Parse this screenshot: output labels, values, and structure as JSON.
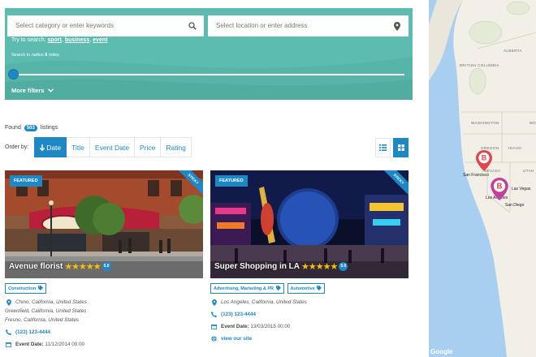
{
  "search": {
    "keyword_placeholder": "Select category or enter keywords",
    "location_placeholder": "Select location or enter address",
    "try_prefix": "Try to search:",
    "try_links": [
      "sport",
      "business",
      "event"
    ],
    "radius_prefix": "Search in radius",
    "radius_value": "0",
    "radius_unit": "miles",
    "more_filters": "More filters"
  },
  "results": {
    "found_prefix": "Found",
    "count": "503",
    "found_suffix": "listings",
    "order_by_label": "Order by:",
    "sort_options": [
      "Date",
      "Title",
      "Event Date",
      "Price",
      "Rating"
    ],
    "active_sort": "Date"
  },
  "listings": [
    {
      "featured": "FEATURED",
      "sticky": "STICKY",
      "title": "Avenue florist",
      "stars": 5,
      "rating": "5.0",
      "tags": [
        "Construction"
      ],
      "addresses": [
        "Chino, California, United States",
        "Greenfield, California, United States",
        "Fresno, California, United States"
      ],
      "phone": "(123) 123-4444",
      "event_label": "Event Date:",
      "event_date": "11/12/2014 00:00"
    },
    {
      "featured": "FEATURED",
      "sticky": "STICKY",
      "title": "Super Shopping in LA",
      "stars": 5,
      "rating": "5.0",
      "tags": [
        "Advertising, Marketing & PR",
        "Automotive"
      ],
      "addresses": [
        "Los Angeles, California, United States"
      ],
      "phone": "(123) 123-4444",
      "event_label": "Event Date:",
      "event_date": "13/03/2015 00:00",
      "site": "view our site"
    }
  ],
  "map": {
    "labels": [
      "ALBERTA",
      "BRITISH COLUMBIA",
      "WASHINGTON",
      "MO",
      "OREGON",
      "IDAHO",
      "NEVADA",
      "UTAH"
    ],
    "cities": [
      "San Francisco",
      "Las Vegas",
      "Los Angeles",
      "San Diego"
    ],
    "marker_icon": "bitcoin-icon",
    "attribution": "Google"
  },
  "colors": {
    "accent": "#1e88c4",
    "panel": "#5cbcb0",
    "star": "#f6c000",
    "marker": "#e0474c"
  }
}
